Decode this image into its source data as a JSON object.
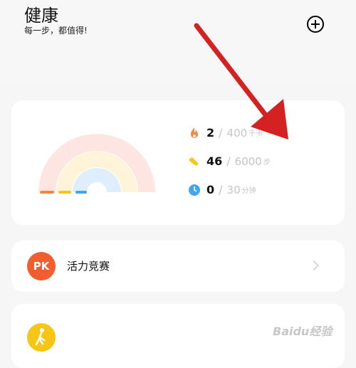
{
  "header": {
    "title": "健康",
    "subtitle": "每一步，都值得!",
    "add_icon": "plus-circle-icon"
  },
  "summary": {
    "stats": [
      {
        "icon": "flame-icon",
        "color": "#f7863a",
        "value": "2",
        "goal": "400",
        "unit": "千卡"
      },
      {
        "icon": "shoe-icon",
        "color": "#f6c619",
        "value": "46",
        "goal": "6000",
        "unit": "步"
      },
      {
        "icon": "clock-icon",
        "color": "#43a5ee",
        "value": "0",
        "goal": "30",
        "unit": "分钟"
      }
    ],
    "progress": {
      "calories": 0.005,
      "steps": 0.0077,
      "minutes": 0.0
    }
  },
  "challenge": {
    "avatar_text": "PK",
    "label": "活力竞赛"
  },
  "walk": {
    "icon": "walking-icon"
  },
  "watermark": "Baidu经验"
}
